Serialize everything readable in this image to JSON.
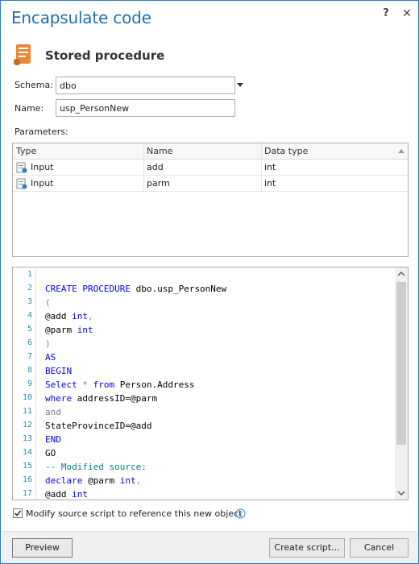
{
  "window": {
    "title": "Encapsulate code",
    "help_glyph": "?",
    "close_glyph": "✕"
  },
  "header": {
    "icon": "stored-procedure-icon",
    "title": "Stored procedure"
  },
  "form": {
    "schema_label": "Schema:",
    "schema_value": "dbo",
    "name_label": "Name:",
    "name_value": "usp_PersonNew",
    "parameters_label": "Parameters:"
  },
  "parameters_grid": {
    "columns": [
      "Type",
      "Name",
      "Data type"
    ],
    "rows": [
      {
        "type": "Input",
        "name": "add",
        "data_type": "int"
      },
      {
        "type": "Input",
        "name": "parm",
        "data_type": "int"
      }
    ]
  },
  "code_editor": {
    "line_numbers": [
      "1",
      "2",
      "3",
      "4",
      "5",
      "6",
      "7",
      "8",
      "9",
      "10",
      "11",
      "12",
      "13",
      "14",
      "15",
      "16",
      "17"
    ],
    "lines": [
      [],
      [
        {
          "t": "CREATE PROCEDURE",
          "c": "kw"
        },
        {
          "t": " dbo.usp_PersonNew",
          "c": ""
        }
      ],
      [
        {
          "t": "(",
          "c": "gr"
        }
      ],
      [
        {
          "t": "@add ",
          "c": ""
        },
        {
          "t": "int",
          "c": "kw"
        },
        {
          "t": ",",
          "c": "gr"
        }
      ],
      [
        {
          "t": "@parm ",
          "c": ""
        },
        {
          "t": "int",
          "c": "kw"
        }
      ],
      [
        {
          "t": ")",
          "c": "gr"
        }
      ],
      [
        {
          "t": "AS",
          "c": "kw"
        }
      ],
      [
        {
          "t": "BEGIN",
          "c": "kw"
        }
      ],
      [
        {
          "t": "Select",
          "c": "kw"
        },
        {
          "t": " * ",
          "c": "gr"
        },
        {
          "t": "from",
          "c": "kw"
        },
        {
          "t": " Person.Address",
          "c": ""
        }
      ],
      [
        {
          "t": "where",
          "c": "kw"
        },
        {
          "t": " addressID=@parm",
          "c": ""
        }
      ],
      [
        {
          "t": "and",
          "c": "gr"
        }
      ],
      [
        {
          "t": "StateProvinceID=@add",
          "c": ""
        }
      ],
      [
        {
          "t": "END",
          "c": "kw"
        }
      ],
      [
        {
          "t": "GO",
          "c": ""
        }
      ],
      [
        {
          "t": "-- Modified source:",
          "c": "cm"
        }
      ],
      [
        {
          "t": "declare",
          "c": "kw"
        },
        {
          "t": " @parm ",
          "c": ""
        },
        {
          "t": "int",
          "c": "kw"
        },
        {
          "t": ",",
          "c": "gr"
        }
      ],
      [
        {
          "t": "@add ",
          "c": ""
        },
        {
          "t": "int",
          "c": "kw"
        }
      ]
    ]
  },
  "options": {
    "modify_source_checked": true,
    "modify_source_label": "Modify source script to reference this new object",
    "info_icon": "info-icon"
  },
  "footer": {
    "preview_label": "Preview",
    "create_script_label": "Create script...",
    "cancel_label": "Cancel"
  },
  "colors": {
    "title": "#1f6fb4",
    "keyword": "#0000ff",
    "line_number": "#2b91af",
    "comment": "#008080",
    "window_border": "#2b79c2"
  }
}
